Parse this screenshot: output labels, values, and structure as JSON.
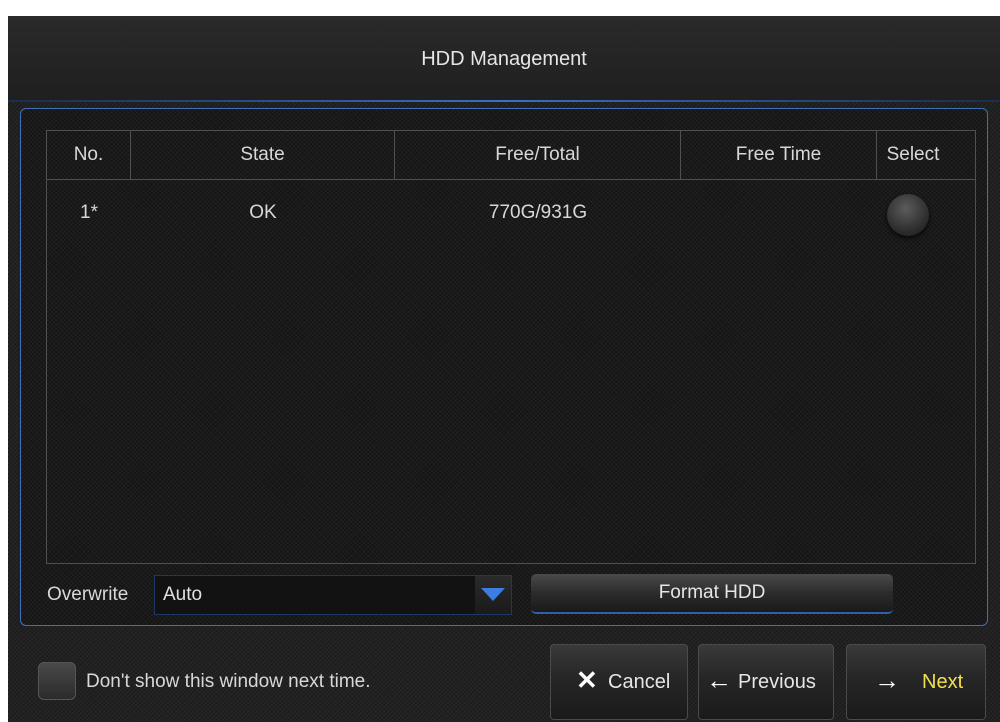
{
  "window": {
    "title": "HDD Management"
  },
  "table": {
    "columns": [
      "No.",
      "State",
      "Free/Total",
      "Free Time",
      "Select"
    ],
    "rows": [
      {
        "no": "1*",
        "state": "OK",
        "free_total": "770G/931G",
        "free_time": ""
      }
    ]
  },
  "overwrite": {
    "label": "Overwrite",
    "value": "Auto"
  },
  "format_button": {
    "label": "Format HDD"
  },
  "footer": {
    "checkbox_label": "Don't show this window next time.",
    "cancel_label": "Cancel",
    "previous_label": "Previous",
    "next_label": "Next"
  },
  "icons": {
    "cancel": "close-icon",
    "previous": "arrow-left-icon",
    "next": "arrow-right-icon",
    "dropdown": "triangle-down-icon"
  },
  "colors": {
    "accent": "#3b7de0",
    "next_label": "#f2e14a"
  }
}
